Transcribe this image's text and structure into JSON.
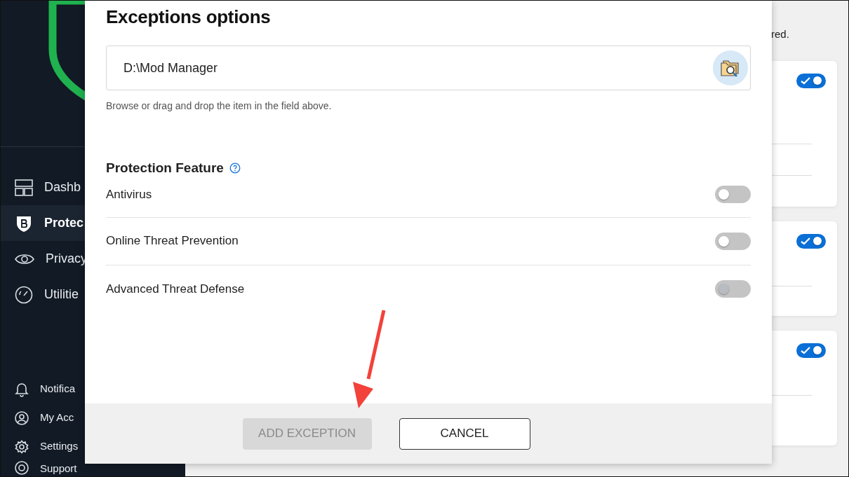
{
  "sidebar": {
    "items": [
      {
        "label": "Dashb",
        "selected": false
      },
      {
        "label": "Protec",
        "selected": true
      },
      {
        "label": "Privacy",
        "selected": false
      },
      {
        "label": "Utilitie",
        "selected": false
      }
    ],
    "bottom_items": [
      {
        "label": "Notifica"
      },
      {
        "label": "My Acc"
      },
      {
        "label": "Settings"
      },
      {
        "label": "Support"
      }
    ]
  },
  "main": {
    "partial_text": "red.",
    "cards": [
      {
        "on": true
      },
      {
        "on": true
      },
      {
        "on": true
      }
    ]
  },
  "dialog": {
    "title": "Exceptions options",
    "path_field": {
      "value": "D:\\Mod Manager"
    },
    "hint": "Browse or drag and drop the item in the field above.",
    "section_title": "Protection Feature",
    "features": [
      {
        "label": "Antivirus",
        "on": false,
        "disabled": false
      },
      {
        "label": "Online Threat Prevention",
        "on": false,
        "disabled": false
      },
      {
        "label": "Advanced Threat Defense",
        "on": false,
        "disabled": true
      }
    ],
    "buttons": [
      {
        "label": "ADD EXCEPTION",
        "kind": "primary",
        "disabled": true
      },
      {
        "label": "CANCEL",
        "kind": "secondary",
        "disabled": false
      }
    ]
  }
}
